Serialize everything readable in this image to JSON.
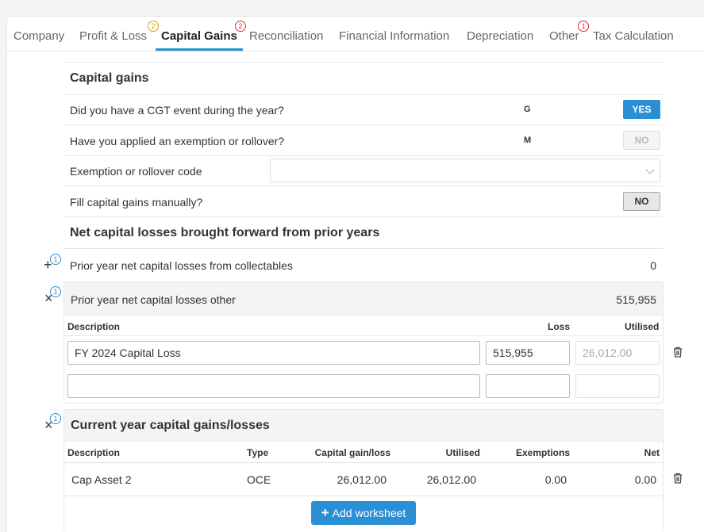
{
  "tabs": [
    {
      "label": "Company"
    },
    {
      "label": "Profit & Loss",
      "badge": "2"
    },
    {
      "label": "Capital Gains",
      "badge": "2"
    },
    {
      "label": "Reconciliation"
    },
    {
      "label": "Financial Information"
    },
    {
      "label": "Depreciation"
    },
    {
      "label": "Other",
      "badge": "1"
    },
    {
      "label": "Tax Calculation"
    }
  ],
  "capital_gains": {
    "title": "Capital gains",
    "q1": {
      "label": "Did you have a CGT event during the year?",
      "code": "G",
      "value": "YES"
    },
    "q2": {
      "label": "Have you applied an exemption or rollover?",
      "code": "M",
      "value": "NO"
    },
    "q3": {
      "label": "Exemption or rollover code",
      "value": ""
    },
    "q4": {
      "label": "Fill capital gains manually?",
      "value": "NO"
    }
  },
  "net_losses": {
    "title": "Net capital losses brought forward from prior years",
    "collectables": {
      "label": "Prior year net capital losses from collectables",
      "value": "0",
      "badge": "1"
    },
    "other": {
      "label": "Prior year net capital losses other",
      "value": "515,955",
      "badge": "1",
      "headers": {
        "description": "Description",
        "loss": "Loss",
        "utilised": "Utilised"
      },
      "rows": [
        {
          "description": "FY 2024 Capital Loss",
          "loss": "515,955",
          "utilised": "26,012.00"
        },
        {
          "description": "",
          "loss": "",
          "utilised": ""
        }
      ]
    }
  },
  "current_year": {
    "title": "Current year capital gains/losses",
    "badge": "1",
    "headers": {
      "description": "Description",
      "type": "Type",
      "gain": "Capital gain/loss",
      "utilised": "Utilised",
      "exemptions": "Exemptions",
      "net": "Net"
    },
    "rows": [
      {
        "description": "Cap Asset 2",
        "type": "OCE",
        "gain": "26,012.00",
        "utilised": "26,012.00",
        "exemptions": "0.00",
        "net": "0.00"
      }
    ],
    "add_button": "Add worksheet"
  },
  "colors": {
    "accent": "#2b8fd6",
    "badge_red": "#d3302f",
    "badge_yellow": "#d4a017"
  },
  "icons": {
    "plus": "plus-icon",
    "close": "close-icon",
    "trash": "trash-icon"
  }
}
